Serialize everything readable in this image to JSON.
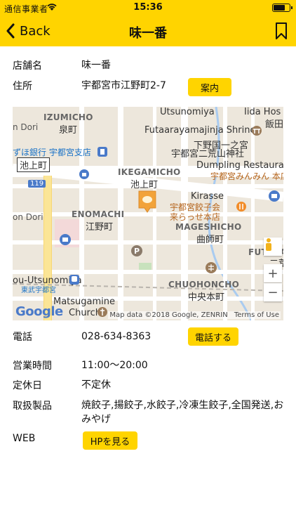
{
  "status": {
    "carrier": "通信事業者",
    "time": "15:36",
    "battery_level": 0.75
  },
  "nav": {
    "back_label": "Back",
    "title": "味一番"
  },
  "shop": {
    "name_label": "店舗名",
    "name": "味一番",
    "address_label": "住所",
    "address": "宇都宮市江野町2-7",
    "guide_button": "案内",
    "phone_label": "電話",
    "phone": "028-634-8363",
    "call_button": "電話する",
    "hours_label": "営業時間",
    "hours": "11:00〜20:00",
    "closed_label": "定休日",
    "closed": "不定休",
    "products_label": "取扱製品",
    "products": "焼餃子,揚餃子,水餃子,冷凍生餃子,全国発送,おみやげ",
    "web_label": "WEB",
    "web_button": "HPを見る"
  },
  "map": {
    "labels": {
      "iidaho": "Iida Hos",
      "iidaho_jp": "飯田",
      "izumicho": "IZUMICHO",
      "izumicho_jp": "泉町",
      "utsunomiya": "Utsunomiya",
      "futaarayama": "Futaarayamajinja Shrine",
      "shimotsuke": "下野国一之宮",
      "shrine_jp": "宇都宮二荒山神社",
      "mizuho": "ずほ銀行 宇都宮支店",
      "ikegamicho_box": "池上町",
      "ikegamicho": "IKEGAMICHO",
      "ikegamicho_jp": "池上町",
      "dumpling": "Dumpling Restaurant",
      "minmin": "宇都宮みんみん 本店",
      "kirasse": "Kirasse",
      "kirasse_jp1": "宇都宮餃子会",
      "kirasse_jp2": "来らっせ本店",
      "enomachi": "ENOMACHI",
      "enomachi_jp": "江野町",
      "mageshicho": "MAGESHICHO",
      "mageshicho_jp": "曲師町",
      "futara": "FUTARA",
      "futara_jp": "二荒",
      "ndori": "n Dori",
      "ondori": "on Dori",
      "route": "119",
      "toutsunomiya": "ou-Utsunomiya",
      "tobu": "東武宇都宮",
      "chuohoncho": "CHUOHONCHO",
      "chuohoncho_jp": "中央本町",
      "matsugamine": "Matsugamine",
      "church": "Church",
      "mapdata": "Map data ©2018 Google, ZENRIN",
      "terms": "Terms of Use",
      "google": "Google",
      "zoom_in": "+",
      "zoom_out": "−"
    }
  },
  "colors": {
    "accent": "#ffd400"
  }
}
